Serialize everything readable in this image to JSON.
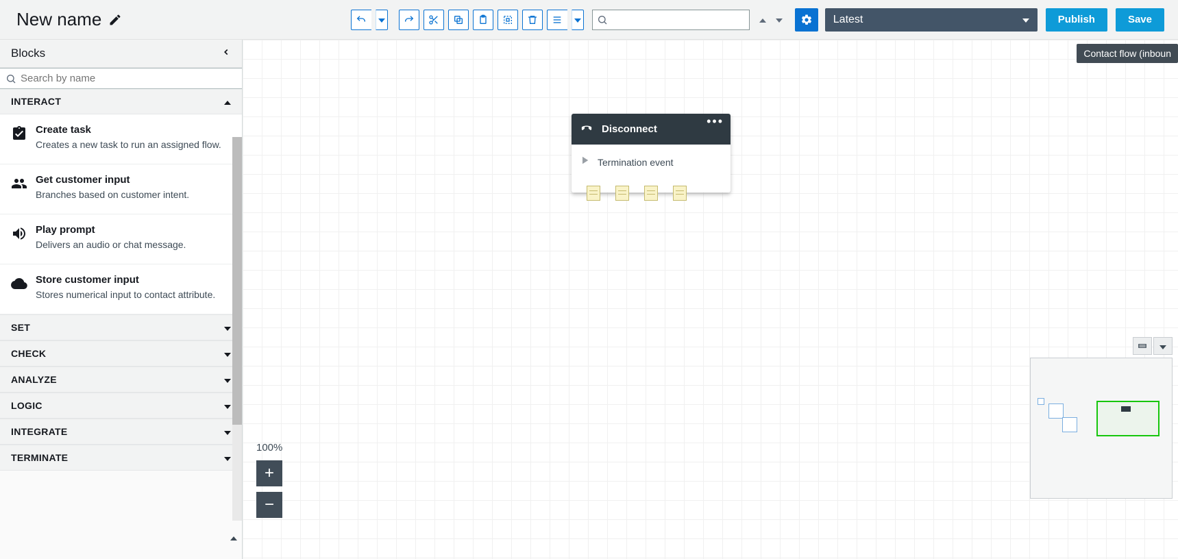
{
  "header": {
    "title": "New name",
    "version_select": "Latest",
    "publish_btn": "Publish",
    "save_btn": "Save"
  },
  "search": {
    "placeholder": ""
  },
  "badge": "Contact flow (inboun",
  "sidebar": {
    "title": "Blocks",
    "search_placeholder": "Search by name",
    "groups": {
      "interact": {
        "label": "INTERACT",
        "expanded": true
      },
      "set": {
        "label": "SET"
      },
      "check": {
        "label": "CHECK"
      },
      "analyze": {
        "label": "ANALYZE"
      },
      "logic": {
        "label": "LOGIC"
      },
      "integrate": {
        "label": "INTEGRATE"
      },
      "terminate": {
        "label": "TERMINATE"
      }
    },
    "interact_blocks": [
      {
        "title": "Create task",
        "desc": "Creates a new task to run an assigned flow."
      },
      {
        "title": "Get customer input",
        "desc": "Branches based on customer intent."
      },
      {
        "title": "Play prompt",
        "desc": "Delivers an audio or chat message."
      },
      {
        "title": "Store customer input",
        "desc": "Stores numerical input to contact attribute."
      }
    ]
  },
  "node": {
    "title": "Disconnect",
    "event": "Termination event"
  },
  "zoom": {
    "label": "100%"
  }
}
